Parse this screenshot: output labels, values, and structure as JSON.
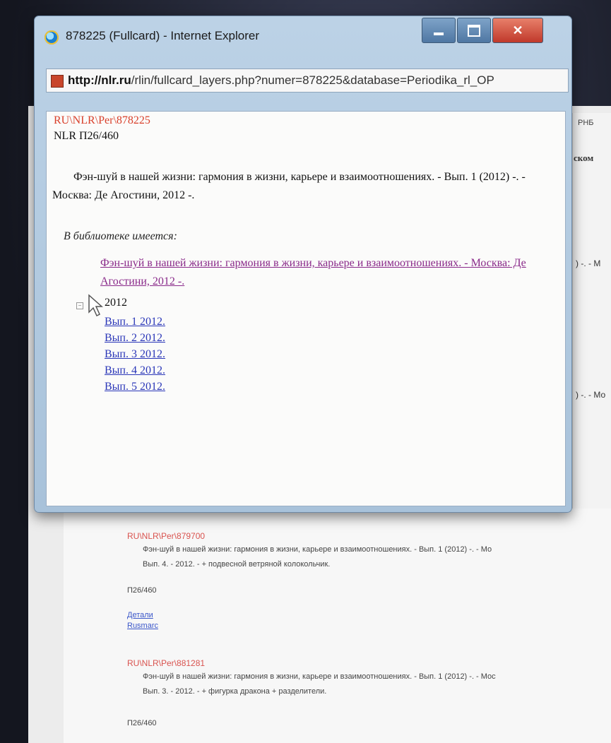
{
  "window": {
    "title": "878225 (Fullcard) - Internet Explorer",
    "address_host": "http://nlr.ru",
    "address_path": "/rlin/fullcard_layers.php?numer=878225&database=Periodika_rl_OP"
  },
  "card": {
    "record_id": "RU\\NLR\\Per\\878225",
    "shelf_mark": "NLR П26/460",
    "description": "Фэн-шуй в нашей жизни: гармония в жизни, карьере и взаимоотношениях. - Вып. 1 (2012) -. - Москва: Де Агостини, 2012 -.",
    "holdings_heading": "В библиотеке имеется:",
    "holding_link": "Фэн-шуй в нашей жизни: гармония в жизни, карьере и взаимоотношениях. - Москва: Де Агостини, 2012 -.",
    "year_node": "2012",
    "issues": [
      "Вып. 1 2012.",
      "Вып. 2 2012.",
      "Вып. 3 2012.",
      "Вып. 4 2012.",
      "Вып. 5 2012."
    ]
  },
  "background": {
    "side_label_1": "РНБ",
    "side_label_2": "ском",
    "side_cut_1": ") -. - М",
    "side_cut_2": ") -. - Мо",
    "records": [
      {
        "id": "RU\\NLR\\Per\\879700",
        "title": "Фэн-шуй в нашей жизни: гармония в жизни, карьере и взаимоотношениях. - Вып. 1 (2012) -. - Мо",
        "issue": "Вып. 4. - 2012. - + подвесной ветряной колокольчик.",
        "code": "П26/460",
        "links": [
          "Детали",
          "Rusmarc"
        ]
      },
      {
        "id": "RU\\NLR\\Per\\881281",
        "title": "Фэн-шуй в нашей жизни: гармония в жизни, карьере и взаимоотношениях. - Вып. 1 (2012) -. - Мос",
        "issue": "Вып. 3. - 2012. - + фигурка дракона + разделители.",
        "code": "П26/460"
      }
    ]
  }
}
